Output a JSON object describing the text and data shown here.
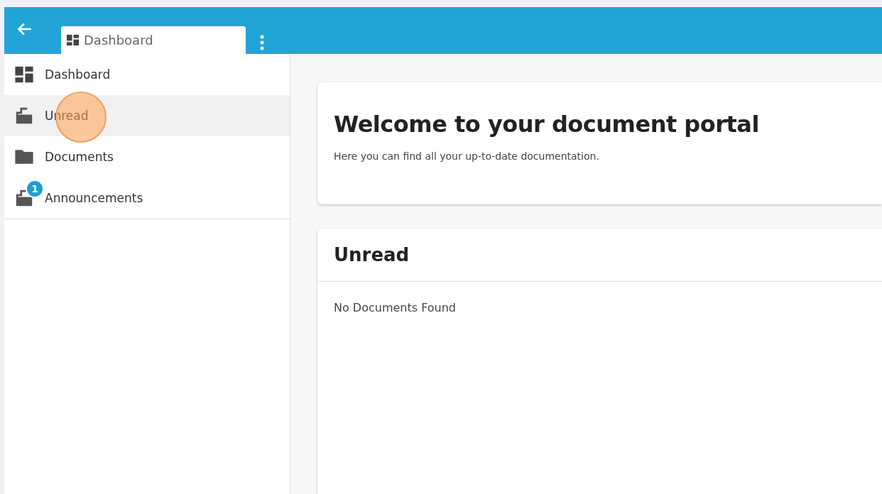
{
  "header": {
    "tab": {
      "label": "Dashboard",
      "kind": "dashboard",
      "selected": true
    }
  },
  "sidebar": {
    "items": [
      {
        "label": "Dashboard",
        "kind": "dashboard",
        "selected": false
      },
      {
        "label": "Unread",
        "kind": "tray",
        "selected": true,
        "clicked": true
      },
      {
        "label": "Documents",
        "kind": "folder",
        "selected": false
      },
      {
        "label": "Announcements",
        "kind": "tray",
        "selected": false,
        "badge": "1"
      }
    ]
  },
  "welcome": {
    "title": "Welcome to your document portal",
    "text": "Here you can find all your up-to-date documentation."
  },
  "unread": {
    "title": "Unread",
    "empty_text": "No Documents Found"
  }
}
